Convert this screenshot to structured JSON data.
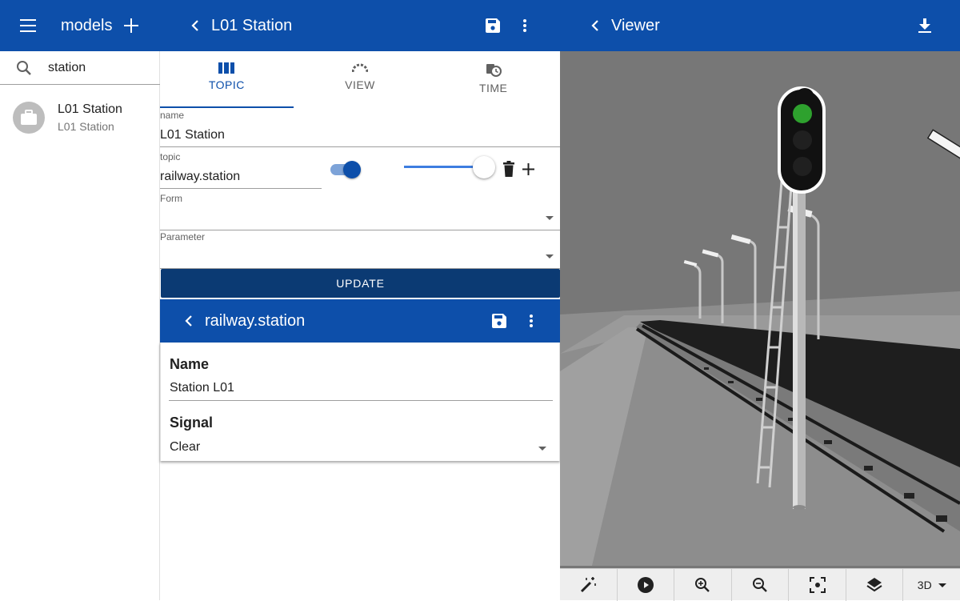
{
  "left_panel": {
    "title": "models",
    "search": {
      "value": "station",
      "placeholder": ""
    },
    "items": [
      {
        "primary": "L01 Station",
        "secondary": "L01 Station"
      }
    ]
  },
  "editor": {
    "title": "L01 Station",
    "tabs": [
      {
        "label": "TOPIC",
        "icon": "topic-columns-icon",
        "active": true
      },
      {
        "label": "VIEW",
        "icon": "view-gauge-icon",
        "active": false
      },
      {
        "label": "TIME",
        "icon": "time-clock-icon",
        "active": false
      }
    ],
    "fields": {
      "name": {
        "label": "name",
        "value": "L01 Station"
      },
      "topic": {
        "label": "topic",
        "value": "railway.station",
        "toggle_on": true,
        "slider_level": 1.0
      },
      "form": {
        "label": "Form",
        "value": ""
      },
      "parameter": {
        "label": "Parameter",
        "value": ""
      }
    },
    "update_label": "UPDATE"
  },
  "subform": {
    "title": "railway.station",
    "fields": {
      "name": {
        "label": "Name",
        "value": "Station L01"
      },
      "signal": {
        "label": "Signal",
        "value": "Clear"
      }
    }
  },
  "viewer": {
    "title": "Viewer",
    "toolbar": {
      "tools": [
        "magic-wand-icon",
        "play-icon",
        "zoom-in-icon",
        "zoom-out-icon",
        "focus-center-icon",
        "layers-icon"
      ],
      "mode_label": "3D"
    }
  },
  "colors": {
    "appbar": "#0d4faa",
    "update_button": "#0b3a73",
    "signal_light_green": "#2ea12e",
    "viewer_background": "#777777"
  }
}
